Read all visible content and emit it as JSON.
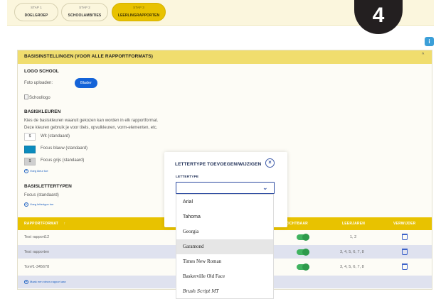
{
  "steps": [
    {
      "sublabel": "STAP 1",
      "label": "DOELGROEP"
    },
    {
      "sublabel": "STAP 2",
      "label": "SCHOOLAMBITIES"
    },
    {
      "sublabel": "STAP 3",
      "label": "LEERLINGRAPPORTEN"
    }
  ],
  "step_badge": "4",
  "info_icon": "i",
  "panel": {
    "title": "BASISINSTELLINGEN (VOOR ALLE RAPPORTFORMATS)",
    "chevron": "^"
  },
  "logo": {
    "heading": "LOGO SCHOOL",
    "upload_label": "Foto uploaden:",
    "browse_label": "Blader",
    "image_alt": "Schoollogo"
  },
  "colors": {
    "heading": "BASISKLEUREN",
    "desc1": "Kies de basiskleuren waaruit gekozen kan worden in elk rapportformat.",
    "desc2": "Deze kleuren gebruik je voor titels, opvulkleuren, vorm-elementen, etc.",
    "items": [
      {
        "swatch_text": "$",
        "label": "Wit (standaard)",
        "color": "#ffffff"
      },
      {
        "swatch_text": "",
        "label": "Focus blauw (standaard)",
        "color": "#0b8bbd"
      },
      {
        "swatch_text": "$",
        "label": "Focus grijs (standaard)",
        "color": "#cfcfcf"
      }
    ],
    "add_link": "Voeg kleur toe"
  },
  "fonts": {
    "heading": "BASISLETTERTYPEN",
    "current": "Focus (standaard)",
    "add_link": "Voeg lettertype toe"
  },
  "table": {
    "headers": {
      "format": "RAPPORTFORMAT",
      "sort": "↑",
      "visible": "ZICHTBAAR",
      "years": "LEERJAREN",
      "delete": "VERWIJDER"
    },
    "rows": [
      {
        "name": "Test rapport12",
        "years": "1, 2"
      },
      {
        "name": "Test rapporten",
        "years": "3, 4, 5, 6, 7, 8"
      },
      {
        "name": "Ton#1-345678",
        "years": "3, 4, 5, 6, 7, 8"
      }
    ],
    "add_link": "Maak een nieuw rapport aan"
  },
  "modal": {
    "title": "LETTERTYPE TOEVOEGEN/WIJZIGEN",
    "close": "×",
    "field_label": "LETTERTYPE",
    "select_value": "",
    "chevron": "⌄",
    "options": [
      "Arial",
      "Tahoma",
      "Georgia",
      "Garamond",
      "Times New Roman",
      "Baskerville Old Face",
      "Brush Script MT"
    ],
    "highlighted_index": 3
  }
}
